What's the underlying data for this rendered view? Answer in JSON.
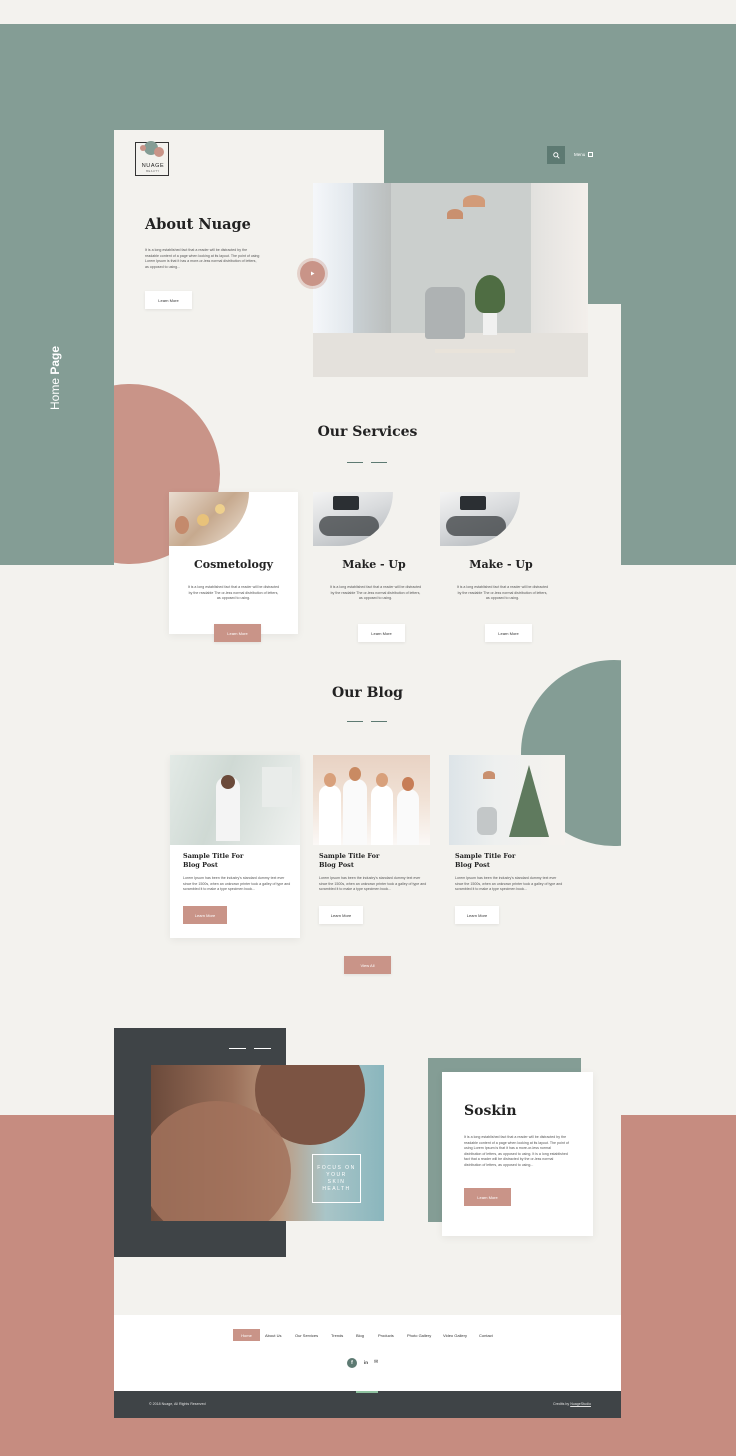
{
  "side_label": {
    "light": "Home ",
    "bold": "Page"
  },
  "header": {
    "logo_top": "NUAGE",
    "logo_sub": "BEAUTY",
    "menu_label": "Menu"
  },
  "about": {
    "title": "About Nuage",
    "text": "It is a long established fact that a reader will be distracted by the readable content of a page when looking at its layout. The point of using Lorem Ipsum is that it has a more-or-less normal distribution of letters, as opposed to using...",
    "button": "Learn More"
  },
  "services": {
    "title": "Our Services",
    "items": [
      {
        "title": "Cosmetology",
        "text": "It is a long established fact that a reader will be distracted by the readable The or-less normal distribution of letters, as opposed to using.",
        "button": "Learn More"
      },
      {
        "title": "Make - Up",
        "text": "It is a long established fact that a reader will be distracted by the readable The or-less normal distribution of letters, as opposed to using.",
        "button": "Learn More"
      },
      {
        "title": "Make - Up",
        "text": "It is a long established fact that a reader will be distracted by the readable The or-less normal distribution of letters, as opposed to using.",
        "button": "Learn More"
      }
    ]
  },
  "blog": {
    "title": "Our Blog",
    "posts": [
      {
        "title": "Sample Title For Blog Post",
        "text": "Lorem Ipsum has been the industry's standard dummy text ever since the 1500s, when an unknown printer took a galley of type and scrambled it to make a type specimen book...",
        "button": "Learn More"
      },
      {
        "title": "Sample Title For Blog Post",
        "text": "Lorem Ipsum has been the industry's standard dummy text ever since the 1500s, when an unknown printer took a galley of type and scrambled it to make a type specimen book...",
        "button": "Learn More"
      },
      {
        "title": "Sample Title For Blog Post",
        "text": "Lorem Ipsum has been the industry's standard dummy text ever since the 1500s, when an unknown printer took a galley of type and scrambled it to make a type specimen book...",
        "button": "Learn More"
      }
    ],
    "view_all": "View All"
  },
  "feature": {
    "badge": "FOCUS ON YOUR SKIN HEALTH",
    "title": "Soskin",
    "text": "It is a long established fact that a reader will be distracted by the readable content of a page when looking at its layout. The point of using Lorem Ipsum is that it has a more-or-less normal distribution of letters, as opposed to using. It is a long established fact that a reader will be distracted by the or-less normal distribution of letters, as opposed to using...",
    "button": "Learn More"
  },
  "nav": {
    "items": [
      "Home",
      "About Us",
      "Our Services",
      "Trends",
      "Blog",
      "Products",
      "Photo Gallery",
      "Video Gallery",
      "Contact"
    ]
  },
  "social": {
    "facebook": "f",
    "linkedin": "in",
    "mail": "✉"
  },
  "footer": {
    "copyright": "© 2018 Nuage, All Rights Reserved",
    "credits_prefix": "Credits by ",
    "credits_link": "NuageStudio"
  },
  "colors": {
    "sage": "#849d95",
    "rose": "#c99488",
    "dark": "#3f4447",
    "cream": "#f3f2ee"
  }
}
